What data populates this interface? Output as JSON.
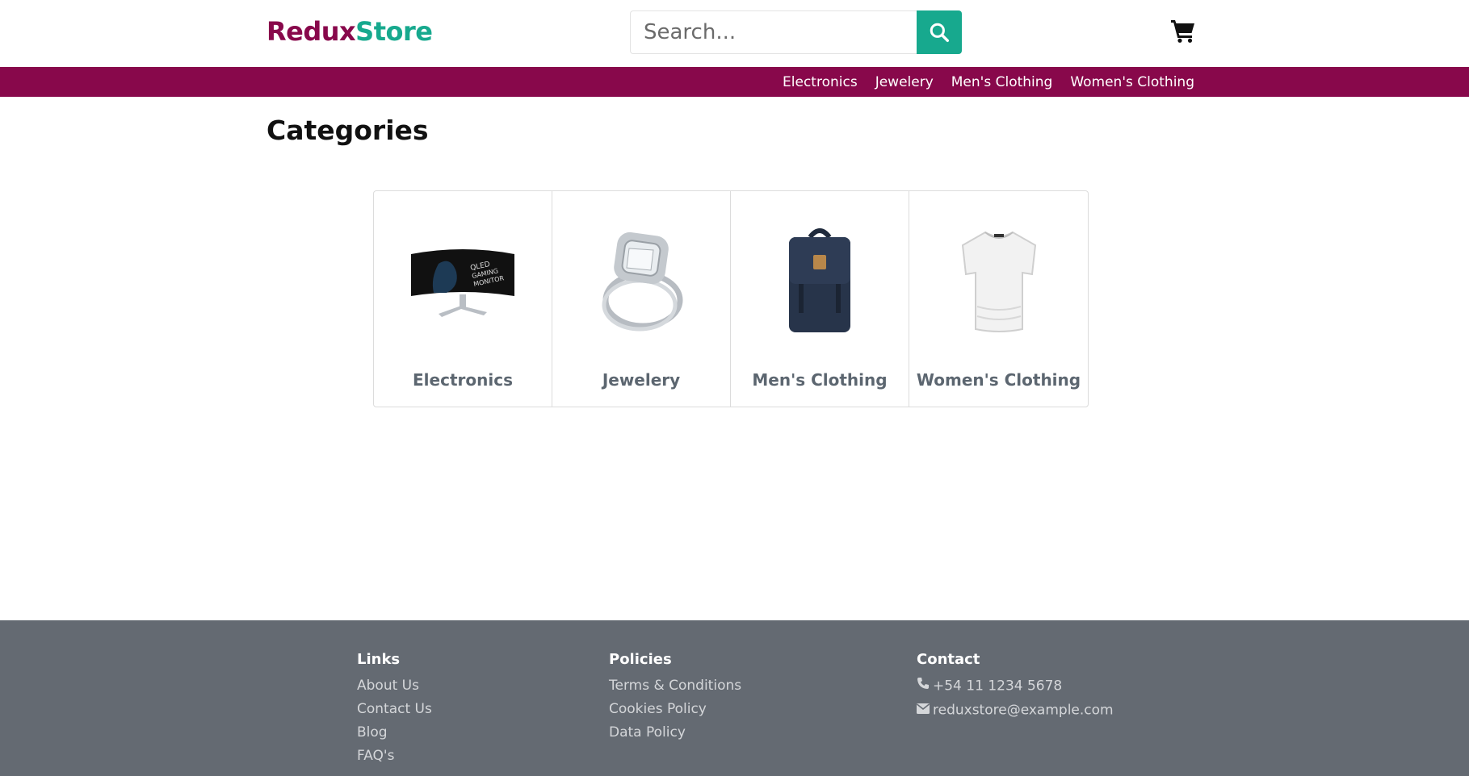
{
  "brand": {
    "part1": "Redux",
    "part2": "Store"
  },
  "search": {
    "placeholder": "Search..."
  },
  "nav": {
    "items": [
      "Electronics",
      "Jewelery",
      "Men's Clothing",
      "Women's Clothing"
    ]
  },
  "main": {
    "title": "Categories",
    "categories": [
      {
        "label": "Electronics",
        "icon": "monitor-image"
      },
      {
        "label": "Jewelery",
        "icon": "ring-image"
      },
      {
        "label": "Men's Clothing",
        "icon": "backpack-image"
      },
      {
        "label": "Women's Clothing",
        "icon": "tshirt-image"
      }
    ]
  },
  "footer": {
    "links": {
      "heading": "Links",
      "items": [
        "About Us",
        "Contact Us",
        "Blog",
        "FAQ's"
      ]
    },
    "policies": {
      "heading": "Policies",
      "items": [
        "Terms & Conditions",
        "Cookies Policy",
        "Data Policy"
      ]
    },
    "contact": {
      "heading": "Contact",
      "phone": "+54 11 1234 5678",
      "email": "reduxstore@example.com"
    }
  },
  "colors": {
    "brand_primary": "#88084b",
    "brand_accent": "#17a98e",
    "footer_bg": "#646a72"
  }
}
